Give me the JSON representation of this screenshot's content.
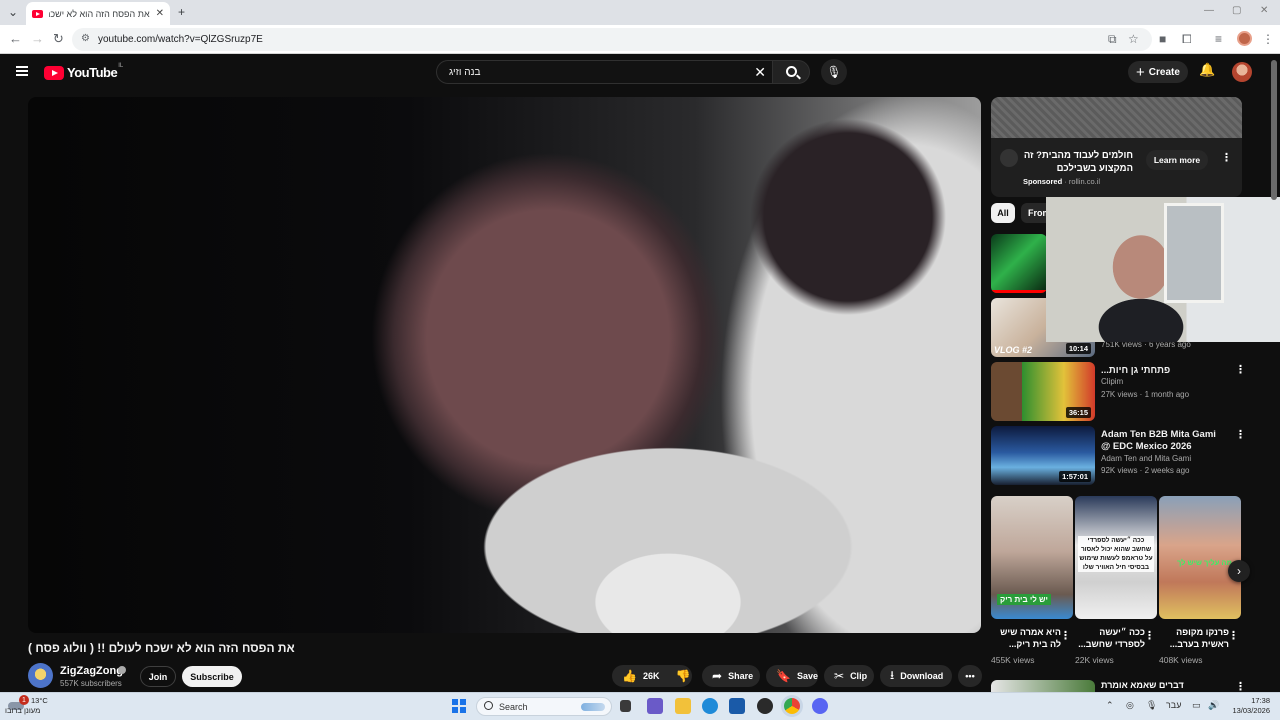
{
  "browser": {
    "tab_title": "את הפסח הזה הוא לא ישכח לעולם !! (וולוג פסח) - YouTube",
    "url": "youtube.com/watch?v=QlZGSruzp7E"
  },
  "header": {
    "logo": "YouTube",
    "country": "IL",
    "search_value": "בנה וזיג",
    "create_label": "Create"
  },
  "video": {
    "title": "את הפסח הזה הוא לא ישכח לעולם !! ( וולוג פסח )",
    "channel": "ZigZagZong",
    "subscribers": "557K subscribers",
    "join_label": "Join",
    "subscribe_label": "Subscribe",
    "likes": "26K",
    "share_label": "Share",
    "save_label": "Save",
    "clip_label": "Clip",
    "download_label": "Download"
  },
  "ad": {
    "text": "חולמים לעבוד מהבית? זה המקצוע בשבילכם",
    "sponsored": "Sponsored",
    "domain": "rollin.co.il",
    "cta": "Learn more"
  },
  "chips": {
    "all": "All",
    "from": "From"
  },
  "recommendations": [
    {
      "thumb_label": "VLOG #2",
      "duration": "10:14",
      "title": "",
      "channel": "",
      "meta": "751K views · 6 years ago"
    },
    {
      "duration": "36:15",
      "title": "פתחתי גן חיות...",
      "channel": "Clipim",
      "meta": "27K views · 1 month ago"
    },
    {
      "duration": "1:57:01",
      "title": "Adam Ten B2B Mita Gami @ EDC Mexico 2026",
      "channel": "Adam Ten and Mita Gami",
      "meta": "92K views · 2 weeks ago"
    }
  ],
  "shorts": [
    {
      "title": "היא אמרה שיש לה בית ריק...",
      "views": "455K views",
      "overlay": "יש לי בית ריק"
    },
    {
      "title": "ככה ״יעשה לספרדי שחשב...",
      "views": "22K views",
      "overlay": "ככה ״יעשה לספרדי שחשב שהוא יכול לאסור על טראמפ לעשות שימוש בבסיסי חיל האוויר שלו"
    },
    {
      "title": "פרנקו מקופה ראשית בערב...",
      "views": "408K views",
      "overlay": "מה עליך שיש לך"
    }
  ],
  "bottom_rec_title": "דברים שאמא אומרת",
  "taskbar": {
    "temperature": "13°C",
    "weather": "מעונן ברובו",
    "badge": "1",
    "search_label": "Search",
    "language": "עבר",
    "time": "17:38",
    "date": "13/03/2026"
  }
}
